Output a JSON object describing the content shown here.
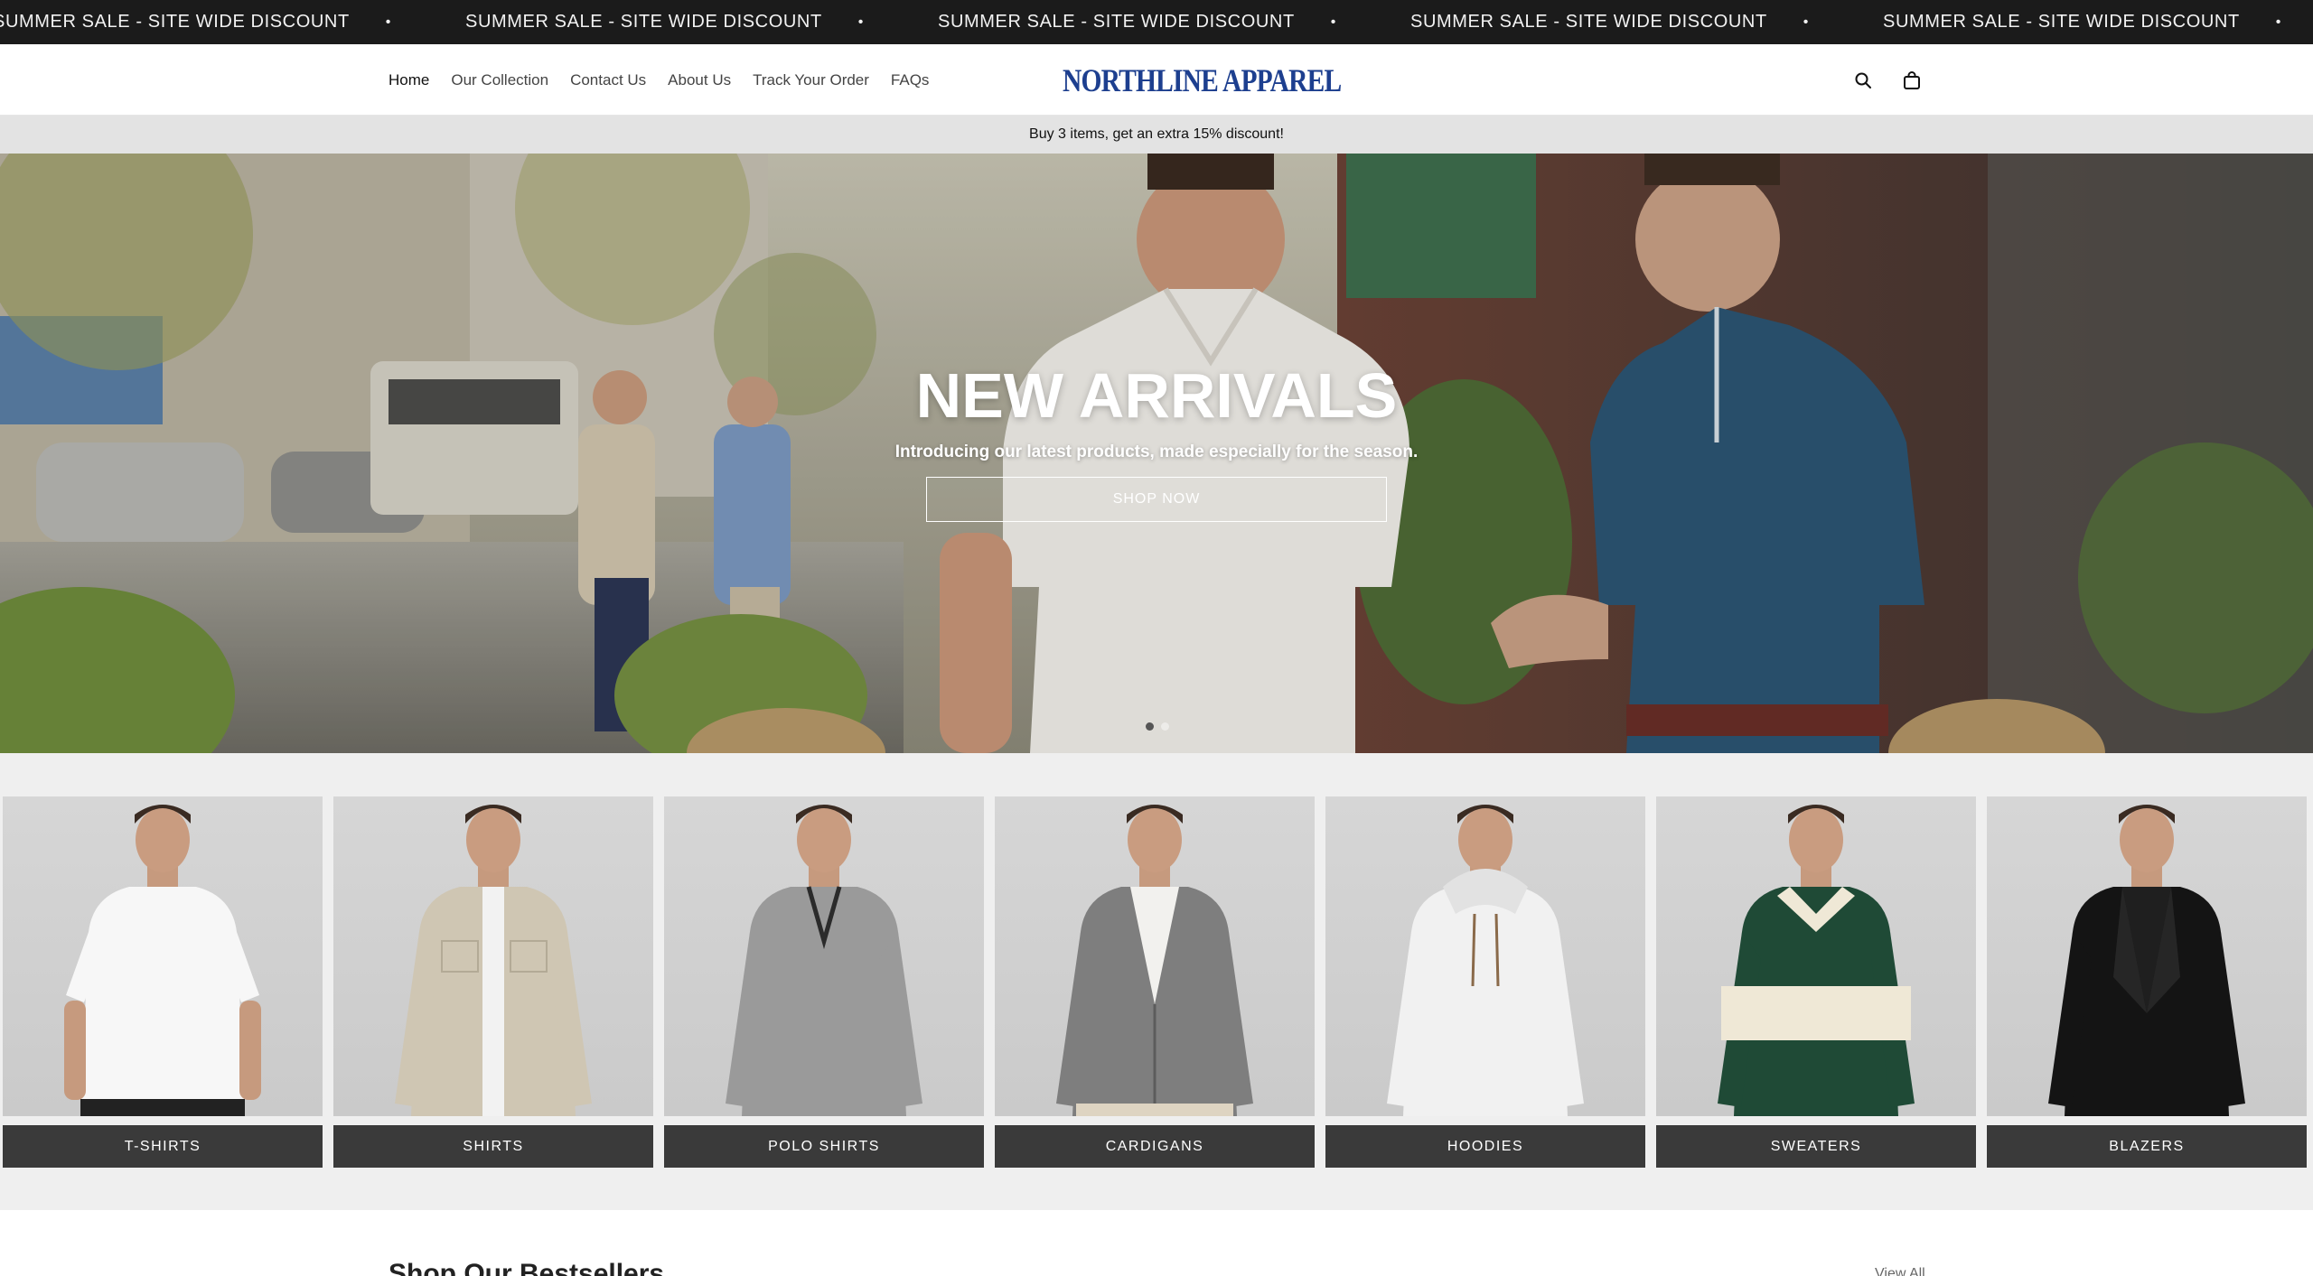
{
  "announcement": {
    "text": "SUMMER SALE - SITE WIDE DISCOUNT",
    "separator": "•",
    "repeat_count": 6,
    "bg_color": "#1b1b1b"
  },
  "header": {
    "nav": [
      {
        "label": "Home",
        "active": true
      },
      {
        "label": "Our Collection",
        "active": false
      },
      {
        "label": "Contact Us",
        "active": false
      },
      {
        "label": "About Us",
        "active": false
      },
      {
        "label": "Track Your Order",
        "active": false
      },
      {
        "label": "FAQs",
        "active": false
      }
    ],
    "logo": "NORTHLINE APPAREL",
    "logo_color": "#1d3f8f",
    "icons": [
      "search-icon",
      "shopping-bag-icon"
    ]
  },
  "promo": {
    "text": "Buy 3 items, get an extra 15% discount!"
  },
  "hero": {
    "title": "NEW ARRIVALS",
    "subtitle": "Introducing our latest products, made especially for the season.",
    "button": "SHOP NOW",
    "slides": 2,
    "active_slide": 1
  },
  "categories": [
    {
      "label": "T-SHIRTS",
      "garment": "#f7f7f7",
      "style": "tee"
    },
    {
      "label": "SHIRTS",
      "garment": "#cfc6b3",
      "style": "shirt"
    },
    {
      "label": "POLO SHIRTS",
      "garment": "#9a9a9a",
      "style": "polo"
    },
    {
      "label": "CARDIGANS",
      "garment": "#7e7e7e",
      "style": "cardigan"
    },
    {
      "label": "HOODIES",
      "garment": "#f1f1f1",
      "style": "hoodie"
    },
    {
      "label": "SWEATERS",
      "garment": "#1f4a36",
      "style": "sweater"
    },
    {
      "label": "BLAZERS",
      "garment": "#141414",
      "style": "blazer"
    }
  ],
  "bestsellers": {
    "title": "Shop Our Bestsellers",
    "view_all": "View All"
  }
}
